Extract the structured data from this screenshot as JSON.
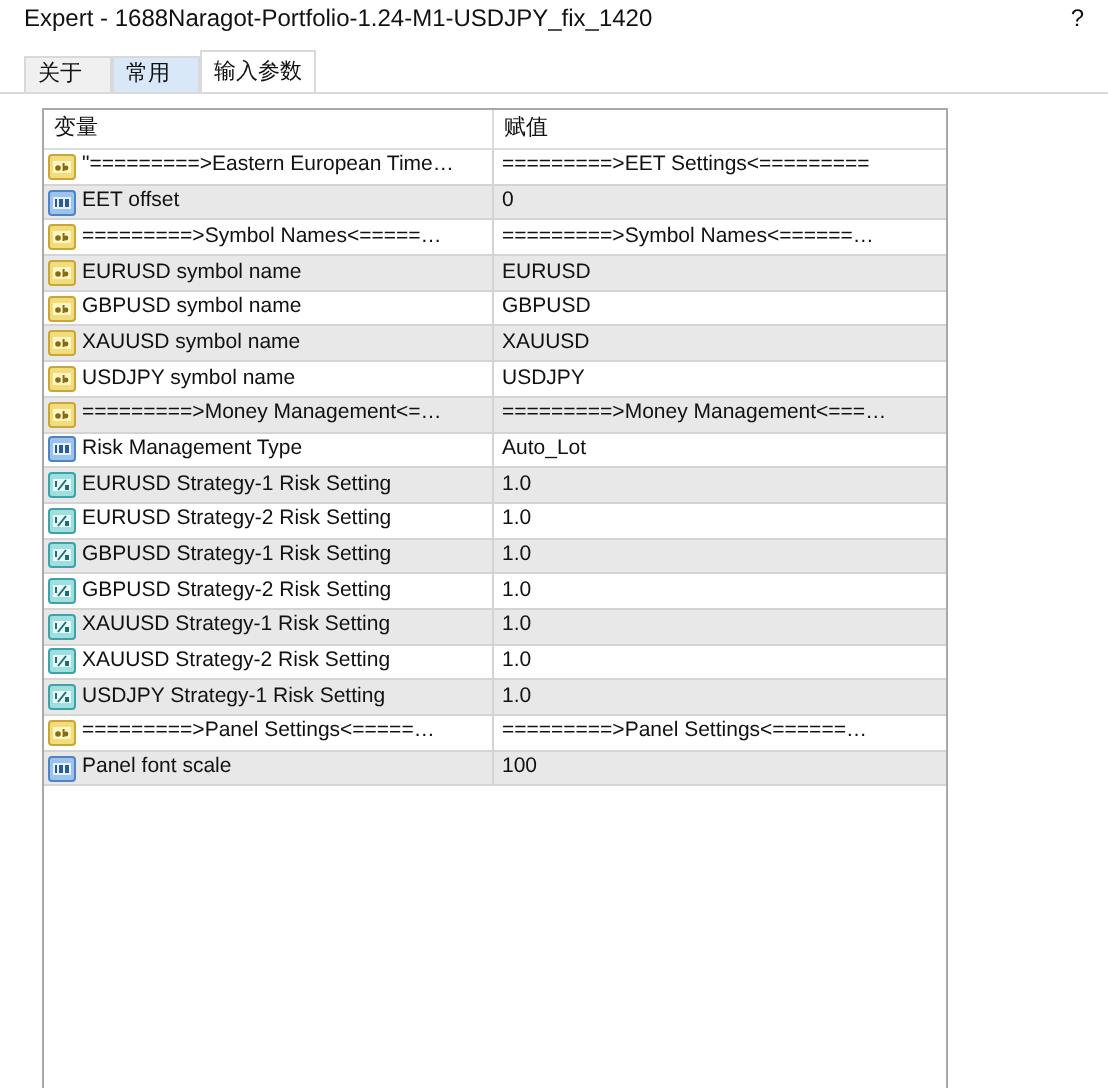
{
  "window": {
    "title": "Expert - 1688Naragot-Portfolio-1.24-M1-USDJPY_fix_1420",
    "help": "?"
  },
  "tabs": [
    {
      "label": "关于",
      "selected": false,
      "highlighted": false
    },
    {
      "label": "常用",
      "selected": false,
      "highlighted": true
    },
    {
      "label": "输入参数",
      "selected": true,
      "highlighted": false
    }
  ],
  "table": {
    "columns": [
      "变量",
      "赋值"
    ],
    "rows": [
      {
        "kind": "string",
        "name": "\"=========>Eastern European Time…",
        "value": "=========>EET Settings<========="
      },
      {
        "kind": "integer",
        "name": "EET offset",
        "value": "0"
      },
      {
        "kind": "string",
        "name": "=========>Symbol Names<=====…",
        "value": "=========>Symbol Names<======…"
      },
      {
        "kind": "string",
        "name": "EURUSD symbol name",
        "value": "EURUSD"
      },
      {
        "kind": "string",
        "name": "GBPUSD symbol name",
        "value": "GBPUSD"
      },
      {
        "kind": "string",
        "name": "XAUUSD symbol name",
        "value": "XAUUSD"
      },
      {
        "kind": "string",
        "name": "USDJPY symbol name",
        "value": "USDJPY"
      },
      {
        "kind": "string",
        "name": "=========>Money Management<=…",
        "value": "=========>Money Management<===…"
      },
      {
        "kind": "integer",
        "name": "Risk Management Type",
        "value": "Auto_Lot"
      },
      {
        "kind": "double",
        "name": "EURUSD Strategy-1 Risk Setting",
        "value": "1.0"
      },
      {
        "kind": "double",
        "name": "EURUSD Strategy-2 Risk Setting",
        "value": "1.0"
      },
      {
        "kind": "double",
        "name": "GBPUSD Strategy-1 Risk Setting",
        "value": "1.0"
      },
      {
        "kind": "double",
        "name": "GBPUSD Strategy-2 Risk Setting",
        "value": "1.0"
      },
      {
        "kind": "double",
        "name": "XAUUSD Strategy-1 Risk Setting",
        "value": "1.0"
      },
      {
        "kind": "double",
        "name": "XAUUSD Strategy-2 Risk Setting",
        "value": "1.0"
      },
      {
        "kind": "double",
        "name": "USDJPY Strategy-1 Risk Setting",
        "value": "1.0"
      },
      {
        "kind": "string",
        "name": "=========>Panel Settings<=====…",
        "value": "=========>Panel Settings<======…"
      },
      {
        "kind": "integer",
        "name": "Panel font scale",
        "value": "100"
      }
    ]
  }
}
